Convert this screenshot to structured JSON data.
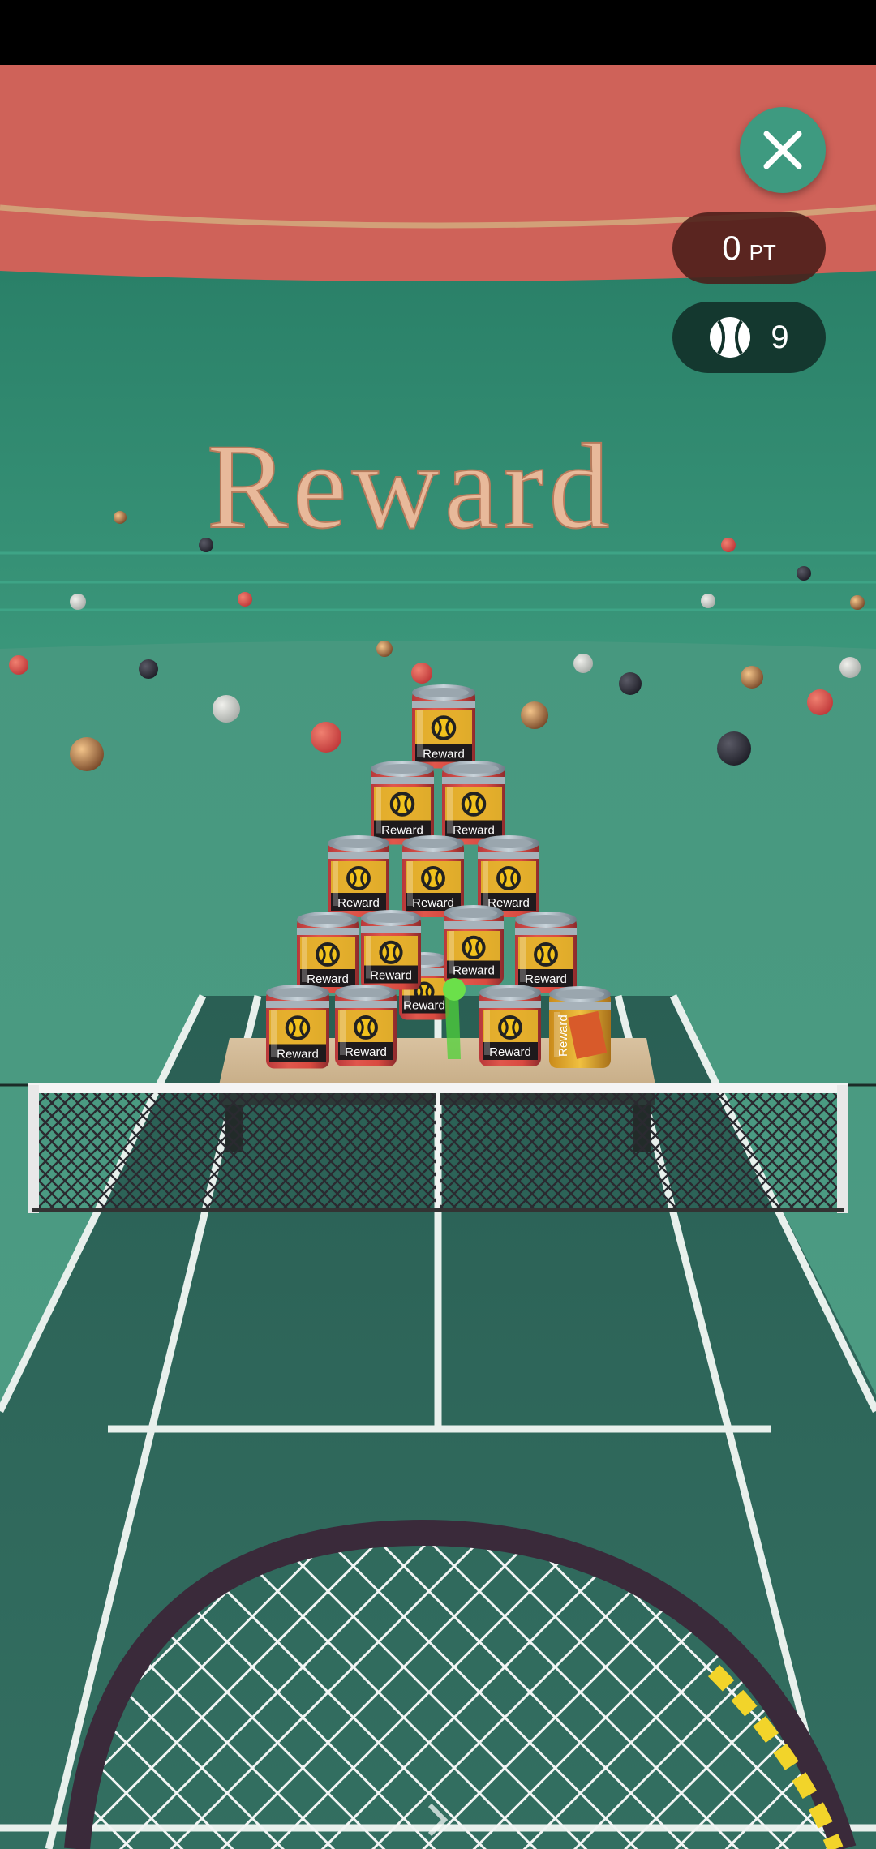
{
  "hud": {
    "points_value": "0",
    "points_unit": "PT",
    "balls_remaining": "9"
  },
  "scene": {
    "sign_text": "Reward",
    "can_label": "Reward",
    "colors": {
      "wall_top": "#cf6259",
      "wall_green": "#2f8b70",
      "floor": "#4c9b82",
      "court": "#2e6b5d",
      "court_lines": "#e8f0ec",
      "close_button": "#3e9a80",
      "racket_frame": "#3a2a3a",
      "racket_accent": "#f2d42a"
    }
  }
}
